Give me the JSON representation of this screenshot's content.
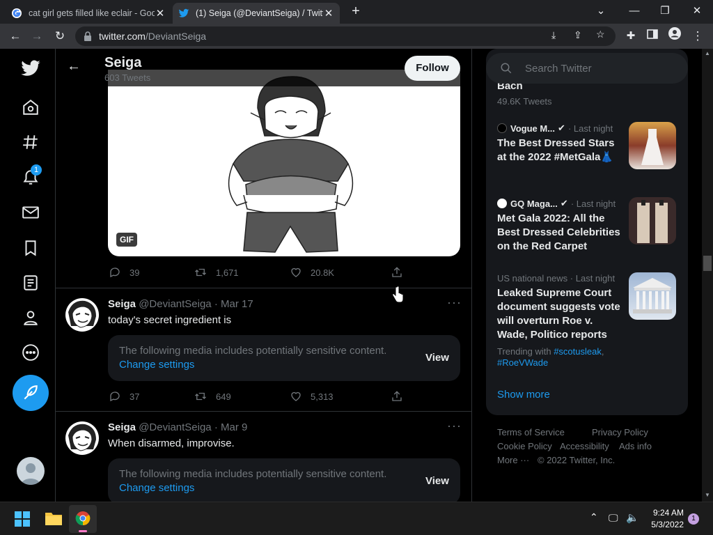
{
  "browser": {
    "tabs": [
      {
        "title": "cat girl gets filled like eclair - Goo",
        "active": false
      },
      {
        "title": "(1) Seiga (@DeviantSeiga) / Twitt",
        "active": true
      }
    ],
    "url_host": "twitter.com",
    "url_path": "/DeviantSeiga"
  },
  "nav": {
    "notification_count": "1"
  },
  "profile_header": {
    "name": "Seiga",
    "tweet_count": "603 Tweets",
    "follow_label": "Follow"
  },
  "tweet1": {
    "gif_badge": "GIF",
    "replies": "39",
    "retweets": "1,671",
    "likes": "20.8K"
  },
  "tweet2": {
    "name": "Seiga",
    "handle": "@DeviantSeiga",
    "dot": "·",
    "date": "Mar 17",
    "text": "today's secret ingredient is",
    "sensitive_notice": "The following media includes potentially sensitive content.",
    "change_settings": "Change settings",
    "view_label": "View",
    "replies": "37",
    "retweets": "649",
    "likes": "5,313"
  },
  "tweet3": {
    "name": "Seiga",
    "handle": "@DeviantSeiga",
    "dot": "·",
    "date": "Mar 9",
    "text": "When disarmed, improvise.",
    "sensitive_notice": "The following media includes potentially sensitive content.",
    "change_settings": "Change settings",
    "view_label": "View"
  },
  "sidebar": {
    "search_placeholder": "Search Twitter",
    "partial_trend": "Bach",
    "partial_trend_count": "49.6K Tweets",
    "trends": [
      {
        "source": "Vogue M...",
        "time": "· Last night",
        "headline": "The Best Dressed Stars at the 2022 #MetGala👗"
      },
      {
        "source": "GQ Maga...",
        "time": "· Last night",
        "headline": "Met Gala 2022: All the Best Dressed Celebrities on the Red Carpet"
      },
      {
        "source": "US national news",
        "time": "· Last night",
        "headline": "Leaked Supreme Court document suggests vote will overturn Roe v. Wade, Politico reports",
        "trending_with": "Trending with",
        "tag1": "#scotusleak",
        "comma": ",",
        "tag2": "#RoeVWade"
      }
    ],
    "show_more": "Show more",
    "footer": {
      "terms": "Terms of Service",
      "privacy": "Privacy Policy",
      "cookie": "Cookie Policy",
      "accessibility": "Accessibility",
      "ads": "Ads info",
      "more": "More ···",
      "copyright": "© 2022 Twitter, Inc."
    }
  },
  "taskbar": {
    "time": "9:24 AM",
    "date": "5/3/2022",
    "notif": "1"
  },
  "colors": {
    "accent": "#1d9bf0",
    "bg": "#000000",
    "card": "#16181c"
  }
}
